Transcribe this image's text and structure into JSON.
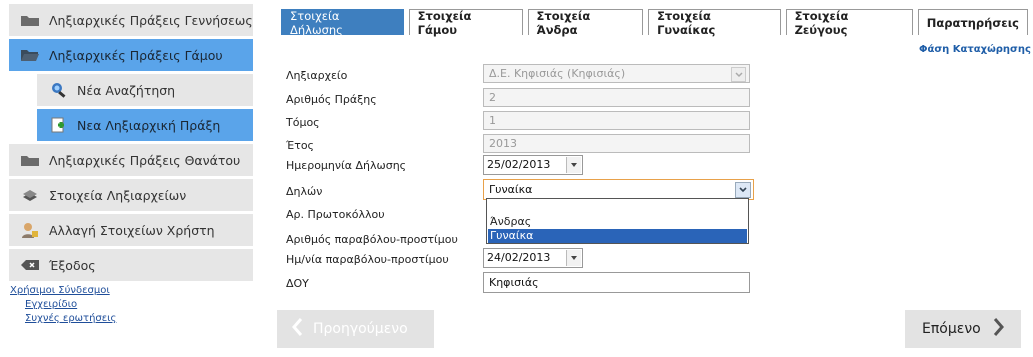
{
  "sidebar": {
    "items": [
      {
        "label": "Ληξιαρχικές Πράξεις Γεννήσεως",
        "icon": "folder-icon"
      },
      {
        "label": "Ληξιαρχικές Πράξεις Γάμου",
        "icon": "folder-open-icon"
      },
      {
        "label": "Νέα Αναζήτηση",
        "icon": "search-person-icon"
      },
      {
        "label": "Νεα Ληξιαρχική Πράξη",
        "icon": "new-document-icon"
      },
      {
        "label": "Ληξιαρχικές Πράξεις Θανάτου",
        "icon": "folder-icon"
      },
      {
        "label": "Στοιχεία Ληξιαρχείων",
        "icon": "stack-icon"
      },
      {
        "label": "Αλλαγή Στοιχείων Χρήστη",
        "icon": "user-lock-icon"
      },
      {
        "label": "Έξοδος",
        "icon": "exit-icon"
      }
    ]
  },
  "links": {
    "title": "Χρήσιμοι Σύνδεσμοι",
    "items": [
      "Εγχειρίδιο",
      "Συχνές ερωτήσεις"
    ]
  },
  "tabs": [
    "Στοιχεία Δήλωσης",
    "Στοιχεία Γάμου",
    "Στοιχεία Άνδρα",
    "Στοιχεία Γυναίκας",
    "Στοιχεία Ζεύγους",
    "Παρατηρήσεις"
  ],
  "phase": "Φάση Καταχώρησης",
  "form": {
    "registry_label": "Ληξιαρχείο",
    "registry_value": "Δ.Ε. Κηφισιάς (Κηφισιάς)",
    "act_number_label": "Αριθμός Πράξης",
    "act_number_value": "2",
    "volume_label": "Τόμος",
    "volume_value": "1",
    "year_label": "Έτος",
    "year_value": "2013",
    "decl_date_label": "Ημερομηνία Δήλωσης",
    "decl_date_value": "25/02/2013",
    "declarant_label": "Δηλών",
    "declarant_value": "Γυναίκα",
    "protocol_label": "Αρ. Πρωτοκόλλου",
    "fee_number_label": "Αριθμός παραβόλου-προστίμου",
    "fee_date_label": "Ημ/νία παραβόλου-προστίμου",
    "fee_date_value": "24/02/2013",
    "doy_label": "ΔΟΥ",
    "doy_value": "Κηφισιάς"
  },
  "dropdown": {
    "options": [
      "",
      "Άνδρας",
      "Γυναίκα"
    ]
  },
  "buttons": {
    "prev": "Προηγούμενο",
    "next": "Επόμενο"
  }
}
